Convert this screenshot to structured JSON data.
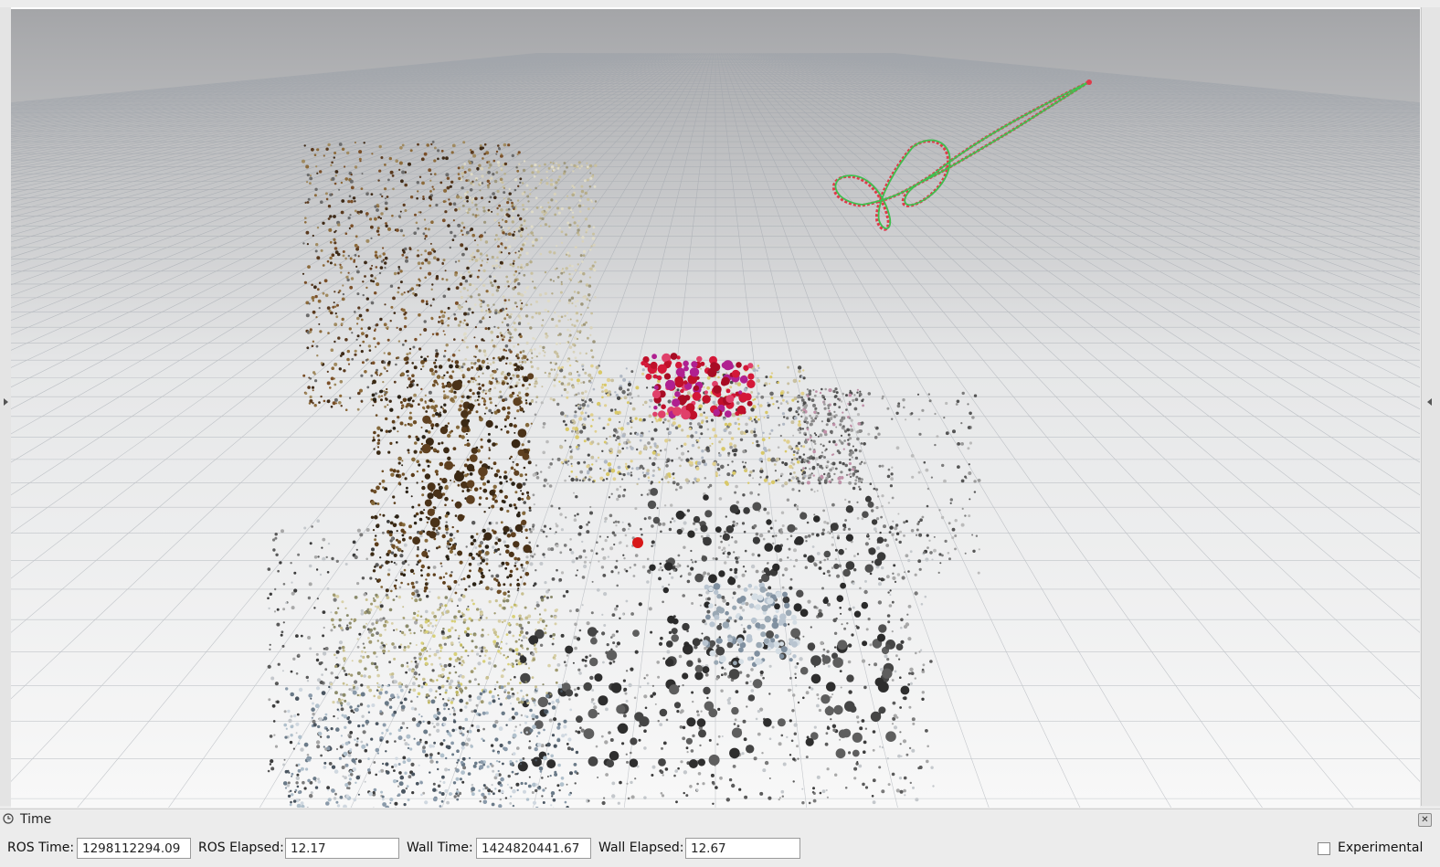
{
  "viewport": {
    "sky_top": "#a4a5a8",
    "sky_bottom": "#f7f7f7",
    "grid_color": "#9aa0a8"
  },
  "time_panel": {
    "title": "Time",
    "close_symbol": "✕",
    "ros_time_label": "ROS Time:",
    "ros_time_value": "1298112294.09",
    "ros_elapsed_label": "ROS Elapsed:",
    "ros_elapsed_value": "12.17",
    "wall_time_label": "Wall Time:",
    "wall_time_value": "1424820441.67",
    "wall_elapsed_label": "Wall Elapsed:",
    "wall_elapsed_value": "12.67",
    "experimental_label": "Experimental",
    "experimental_checked": false
  },
  "icons": {
    "panel_icon": "clock-icon",
    "close": "close-icon"
  }
}
